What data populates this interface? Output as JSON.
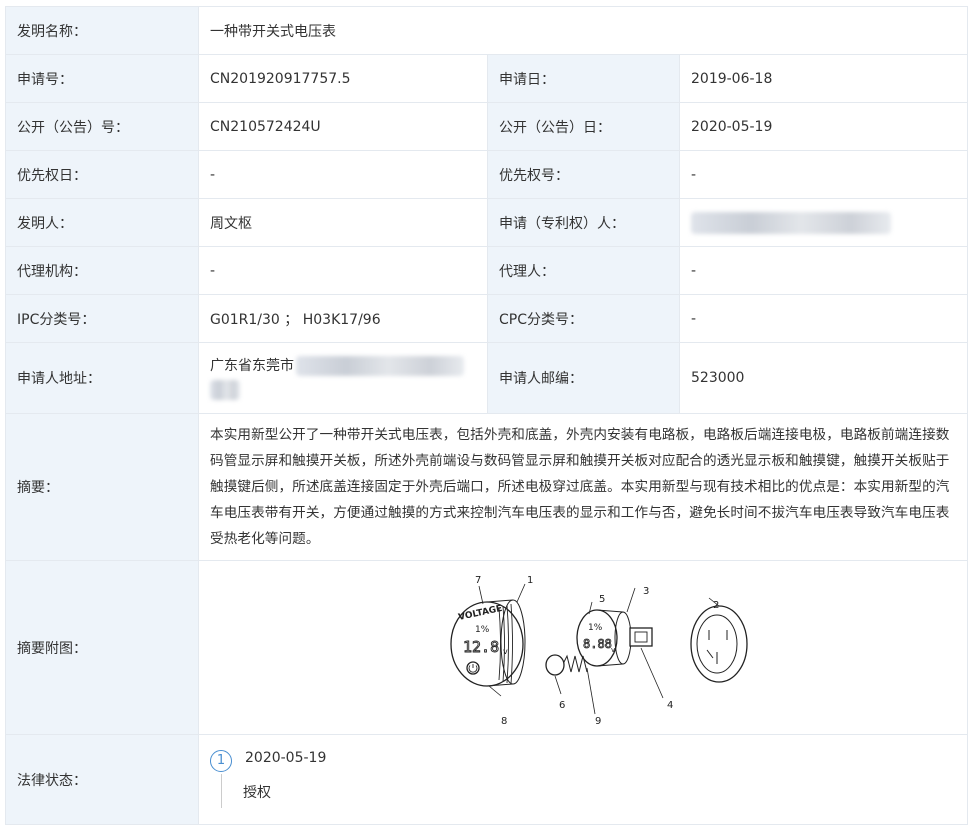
{
  "rows": {
    "title": {
      "label": "发明名称：",
      "value": "一种带开关式电压表"
    },
    "app_no": {
      "label": "申请号：",
      "value": "CN201920917757.5"
    },
    "app_date": {
      "label": "申请日：",
      "value": "2019-06-18"
    },
    "pub_no": {
      "label": "公开（公告）号：",
      "value": "CN210572424U"
    },
    "pub_date": {
      "label": "公开（公告）日：",
      "value": "2020-05-19"
    },
    "priority_date": {
      "label": "优先权日：",
      "value": "-"
    },
    "priority_no": {
      "label": "优先权号：",
      "value": "-"
    },
    "inventor": {
      "label": "发明人：",
      "value": "周文枢"
    },
    "applicant": {
      "label": "申请（专利权）人：",
      "value": ""
    },
    "agency": {
      "label": "代理机构：",
      "value": "-"
    },
    "agent": {
      "label": "代理人：",
      "value": "-"
    },
    "ipc": {
      "label": "IPC分类号：",
      "value": "G01R1/30 ； H03K17/96"
    },
    "cpc": {
      "label": "CPC分类号：",
      "value": "-"
    },
    "address": {
      "label": "申请人地址：",
      "value": "广东省东莞市"
    },
    "postcode": {
      "label": "申请人邮编：",
      "value": "523000"
    },
    "abstract": {
      "label": "摘要：",
      "value": "本实用新型公开了一种带开关式电压表，包括外壳和底盖，外壳内安装有电路板，电路板后端连接电极，电路板前端连接数码管显示屏和触摸开关板，所述外壳前端设与数码管显示屏和触摸开关板对应配合的透光显示板和触摸键，触摸开关板贴于触摸键后侧，所述底盖连接固定于外壳后端口，所述电极穿过底盖。本实用新型与现有技术相比的优点是：本实用新型的汽车电压表带有开关，方便通过触摸的方式来控制汽车电压表的显示和工作与否，避免长时间不拔汽车电压表导致汽车电压表受热老化等问题。"
    },
    "figure": {
      "label": "摘要附图："
    },
    "legal": {
      "label": "法律状态："
    }
  },
  "figure": {
    "display_text": {
      "brand": "VOLTAGE",
      "mark": "1%",
      "reading": "12.8",
      "unit": "v",
      "reading2": "8.88"
    },
    "callouts": [
      "7",
      "1",
      "5",
      "3",
      "2",
      "8",
      "6",
      "9",
      "4"
    ]
  },
  "legal_status": {
    "step": "1",
    "date": "2020-05-19",
    "status": "授权"
  }
}
